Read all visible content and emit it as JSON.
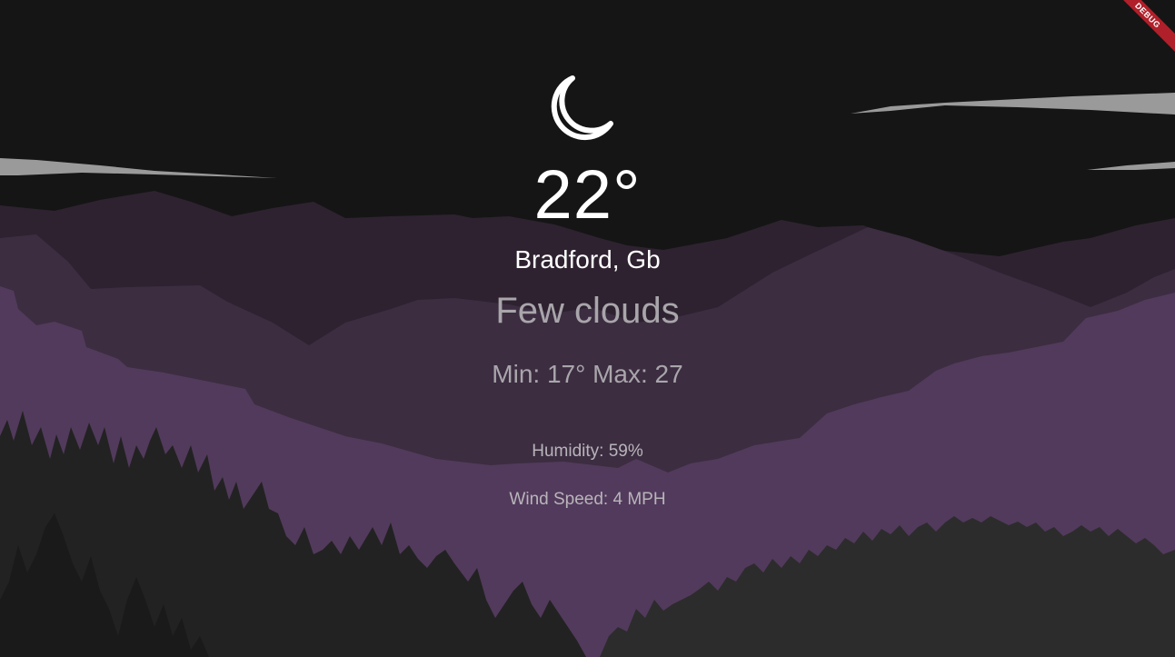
{
  "weather": {
    "icon": "moon-icon",
    "temperature": "22°",
    "location": "Bradford, Gb",
    "description": "Few clouds",
    "min_max": "Min: 17° Max: 27",
    "humidity": "Humidity: 59%",
    "wind_speed": "Wind Speed: 4 MPH"
  },
  "banner": {
    "label": "DEBUG"
  },
  "colors": {
    "sky": "#151515",
    "cloud": "#9a9a9a",
    "mountain_back": "#2e2230",
    "mountain_mid": "#3c2d41",
    "mountain_front": "#523a5c",
    "trees_left": "#222222",
    "trees_right": "#2c2c2c",
    "text_primary": "#ffffff",
    "text_secondary": "#a9a6ab",
    "debug_banner": "#b0202a"
  }
}
